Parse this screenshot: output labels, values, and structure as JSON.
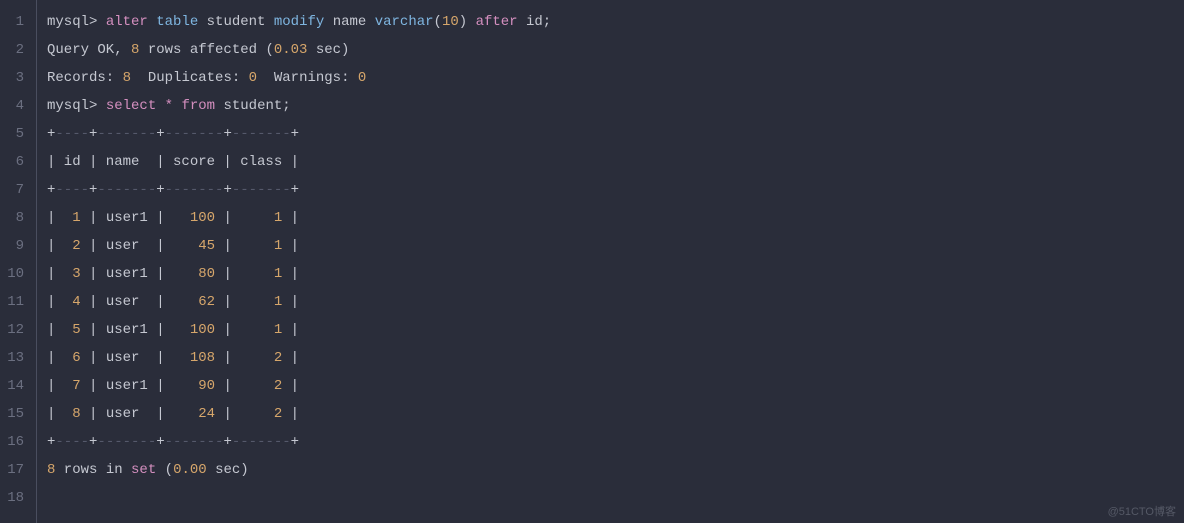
{
  "lines": [
    {
      "n": 1,
      "segs": [
        {
          "cls": "ident",
          "t": "mysql> "
        },
        {
          "cls": "kw1",
          "t": "alter"
        },
        {
          "cls": "ident",
          "t": " "
        },
        {
          "cls": "kw2",
          "t": "table"
        },
        {
          "cls": "ident",
          "t": " student "
        },
        {
          "cls": "kw2",
          "t": "modify"
        },
        {
          "cls": "ident",
          "t": " name "
        },
        {
          "cls": "type",
          "t": "varchar"
        },
        {
          "cls": "punct",
          "t": "("
        },
        {
          "cls": "num",
          "t": "10"
        },
        {
          "cls": "punct",
          "t": ") "
        },
        {
          "cls": "kw1",
          "t": "after"
        },
        {
          "cls": "ident",
          "t": " id;"
        }
      ]
    },
    {
      "n": 2,
      "segs": [
        {
          "cls": "ident",
          "t": "Query OK, "
        },
        {
          "cls": "num",
          "t": "8"
        },
        {
          "cls": "ident",
          "t": " rows affected ("
        },
        {
          "cls": "num",
          "t": "0.03"
        },
        {
          "cls": "ident",
          "t": " sec)"
        }
      ]
    },
    {
      "n": 3,
      "segs": [
        {
          "cls": "ident",
          "t": "Records: "
        },
        {
          "cls": "num",
          "t": "8"
        },
        {
          "cls": "ident",
          "t": "  Duplicates: "
        },
        {
          "cls": "num",
          "t": "0"
        },
        {
          "cls": "ident",
          "t": "  Warnings: "
        },
        {
          "cls": "num",
          "t": "0"
        }
      ]
    },
    {
      "n": 4,
      "segs": [
        {
          "cls": "ident",
          "t": ""
        }
      ]
    },
    {
      "n": 5,
      "segs": [
        {
          "cls": "ident",
          "t": "mysql> "
        },
        {
          "cls": "kw1",
          "t": "select"
        },
        {
          "cls": "ident",
          "t": " "
        },
        {
          "cls": "star",
          "t": "*"
        },
        {
          "cls": "ident",
          "t": " "
        },
        {
          "cls": "kw1",
          "t": "from"
        },
        {
          "cls": "ident",
          "t": " student;"
        }
      ]
    },
    {
      "n": 6,
      "segs": [
        {
          "cls": "ident",
          "t": "+"
        },
        {
          "cls": "dim",
          "t": "----"
        },
        {
          "cls": "ident",
          "t": "+"
        },
        {
          "cls": "dim",
          "t": "-------"
        },
        {
          "cls": "ident",
          "t": "+"
        },
        {
          "cls": "dim",
          "t": "-------"
        },
        {
          "cls": "ident",
          "t": "+"
        },
        {
          "cls": "dim",
          "t": "-------"
        },
        {
          "cls": "ident",
          "t": "+"
        }
      ]
    },
    {
      "n": 7,
      "segs": [
        {
          "cls": "ident",
          "t": "| id | name  | score | class |"
        }
      ]
    },
    {
      "n": 8,
      "segs": [
        {
          "cls": "ident",
          "t": "+"
        },
        {
          "cls": "dim",
          "t": "----"
        },
        {
          "cls": "ident",
          "t": "+"
        },
        {
          "cls": "dim",
          "t": "-------"
        },
        {
          "cls": "ident",
          "t": "+"
        },
        {
          "cls": "dim",
          "t": "-------"
        },
        {
          "cls": "ident",
          "t": "+"
        },
        {
          "cls": "dim",
          "t": "-------"
        },
        {
          "cls": "ident",
          "t": "+"
        }
      ]
    },
    {
      "n": 9,
      "segs": [
        {
          "cls": "ident",
          "t": "|  "
        },
        {
          "cls": "num",
          "t": "1"
        },
        {
          "cls": "ident",
          "t": " | user1 |   "
        },
        {
          "cls": "num",
          "t": "100"
        },
        {
          "cls": "ident",
          "t": " |     "
        },
        {
          "cls": "num",
          "t": "1"
        },
        {
          "cls": "ident",
          "t": " |"
        }
      ]
    },
    {
      "n": 10,
      "segs": [
        {
          "cls": "ident",
          "t": "|  "
        },
        {
          "cls": "num",
          "t": "2"
        },
        {
          "cls": "ident",
          "t": " | user  |    "
        },
        {
          "cls": "num",
          "t": "45"
        },
        {
          "cls": "ident",
          "t": " |     "
        },
        {
          "cls": "num",
          "t": "1"
        },
        {
          "cls": "ident",
          "t": " |"
        }
      ]
    },
    {
      "n": 11,
      "segs": [
        {
          "cls": "ident",
          "t": "|  "
        },
        {
          "cls": "num",
          "t": "3"
        },
        {
          "cls": "ident",
          "t": " | user1 |    "
        },
        {
          "cls": "num",
          "t": "80"
        },
        {
          "cls": "ident",
          "t": " |     "
        },
        {
          "cls": "num",
          "t": "1"
        },
        {
          "cls": "ident",
          "t": " |"
        }
      ]
    },
    {
      "n": 12,
      "segs": [
        {
          "cls": "ident",
          "t": "|  "
        },
        {
          "cls": "num",
          "t": "4"
        },
        {
          "cls": "ident",
          "t": " | user  |    "
        },
        {
          "cls": "num",
          "t": "62"
        },
        {
          "cls": "ident",
          "t": " |     "
        },
        {
          "cls": "num",
          "t": "1"
        },
        {
          "cls": "ident",
          "t": " |"
        }
      ]
    },
    {
      "n": 13,
      "segs": [
        {
          "cls": "ident",
          "t": "|  "
        },
        {
          "cls": "num",
          "t": "5"
        },
        {
          "cls": "ident",
          "t": " | user1 |   "
        },
        {
          "cls": "num",
          "t": "100"
        },
        {
          "cls": "ident",
          "t": " |     "
        },
        {
          "cls": "num",
          "t": "1"
        },
        {
          "cls": "ident",
          "t": " |"
        }
      ]
    },
    {
      "n": 14,
      "segs": [
        {
          "cls": "ident",
          "t": "|  "
        },
        {
          "cls": "num",
          "t": "6"
        },
        {
          "cls": "ident",
          "t": " | user  |   "
        },
        {
          "cls": "num",
          "t": "108"
        },
        {
          "cls": "ident",
          "t": " |     "
        },
        {
          "cls": "num",
          "t": "2"
        },
        {
          "cls": "ident",
          "t": " |"
        }
      ]
    },
    {
      "n": 15,
      "segs": [
        {
          "cls": "ident",
          "t": "|  "
        },
        {
          "cls": "num",
          "t": "7"
        },
        {
          "cls": "ident",
          "t": " | user1 |    "
        },
        {
          "cls": "num",
          "t": "90"
        },
        {
          "cls": "ident",
          "t": " |     "
        },
        {
          "cls": "num",
          "t": "2"
        },
        {
          "cls": "ident",
          "t": " |"
        }
      ]
    },
    {
      "n": 16,
      "segs": [
        {
          "cls": "ident",
          "t": "|  "
        },
        {
          "cls": "num",
          "t": "8"
        },
        {
          "cls": "ident",
          "t": " | user  |    "
        },
        {
          "cls": "num",
          "t": "24"
        },
        {
          "cls": "ident",
          "t": " |     "
        },
        {
          "cls": "num",
          "t": "2"
        },
        {
          "cls": "ident",
          "t": " |"
        }
      ]
    },
    {
      "n": 17,
      "segs": [
        {
          "cls": "ident",
          "t": "+"
        },
        {
          "cls": "dim",
          "t": "----"
        },
        {
          "cls": "ident",
          "t": "+"
        },
        {
          "cls": "dim",
          "t": "-------"
        },
        {
          "cls": "ident",
          "t": "+"
        },
        {
          "cls": "dim",
          "t": "-------"
        },
        {
          "cls": "ident",
          "t": "+"
        },
        {
          "cls": "dim",
          "t": "-------"
        },
        {
          "cls": "ident",
          "t": "+"
        }
      ]
    },
    {
      "n": 18,
      "segs": [
        {
          "cls": "num",
          "t": "8"
        },
        {
          "cls": "ident",
          "t": " rows in "
        },
        {
          "cls": "kw1",
          "t": "set"
        },
        {
          "cls": "ident",
          "t": " ("
        },
        {
          "cls": "num",
          "t": "0.00"
        },
        {
          "cls": "ident",
          "t": " sec)"
        }
      ]
    }
  ],
  "watermark": "@51CTO博客",
  "chart_data": {
    "type": "table",
    "title": "student",
    "columns": [
      "id",
      "name",
      "score",
      "class"
    ],
    "rows": [
      [
        1,
        "user1",
        100,
        1
      ],
      [
        2,
        "user",
        45,
        1
      ],
      [
        3,
        "user1",
        80,
        1
      ],
      [
        4,
        "user",
        62,
        1
      ],
      [
        5,
        "user1",
        100,
        1
      ],
      [
        6,
        "user",
        108,
        2
      ],
      [
        7,
        "user1",
        90,
        2
      ],
      [
        8,
        "user",
        24,
        2
      ]
    ],
    "query_ok": {
      "rows_affected": 8,
      "seconds": 0.03,
      "records": 8,
      "duplicates": 0,
      "warnings": 0
    },
    "select_summary": {
      "rows": 8,
      "seconds": 0.0
    }
  }
}
